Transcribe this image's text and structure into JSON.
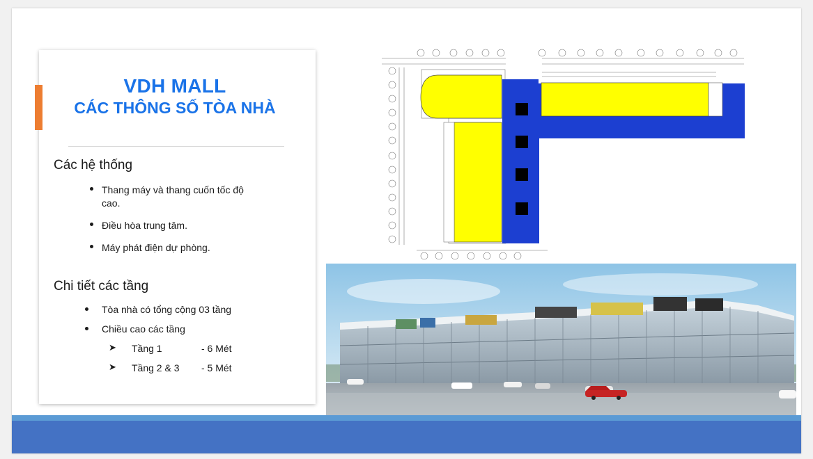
{
  "card": {
    "title_line1": "VDH MALL",
    "title_line2": "CÁC THÔNG SỐ TÒA NHÀ",
    "section1": {
      "heading": "Các hệ thống",
      "bullets": [
        "Thang máy và thang cuốn tốc độ",
        "cao.",
        "Điều hòa trung tâm.",
        "Máy phát điện dự phòng."
      ]
    },
    "section2": {
      "heading": "Chi tiết các tầng",
      "bullets": [
        "Tòa nhà có tổng cộng 03 tầng",
        "Chiều cao các tầng"
      ],
      "floors": [
        {
          "name": "Tầng 1",
          "height": "-  6 Mét"
        },
        {
          "name": "Tầng 2 & 3",
          "height": "-  5 Mét"
        }
      ]
    }
  },
  "colors": {
    "title": "#1a73e8",
    "accent_bar": "#ed7d31",
    "plan_yellow": "#ffff00",
    "plan_blue": "#1c3fd1",
    "footer_light": "#5b9bd5",
    "footer_dark": "#4472c4"
  }
}
